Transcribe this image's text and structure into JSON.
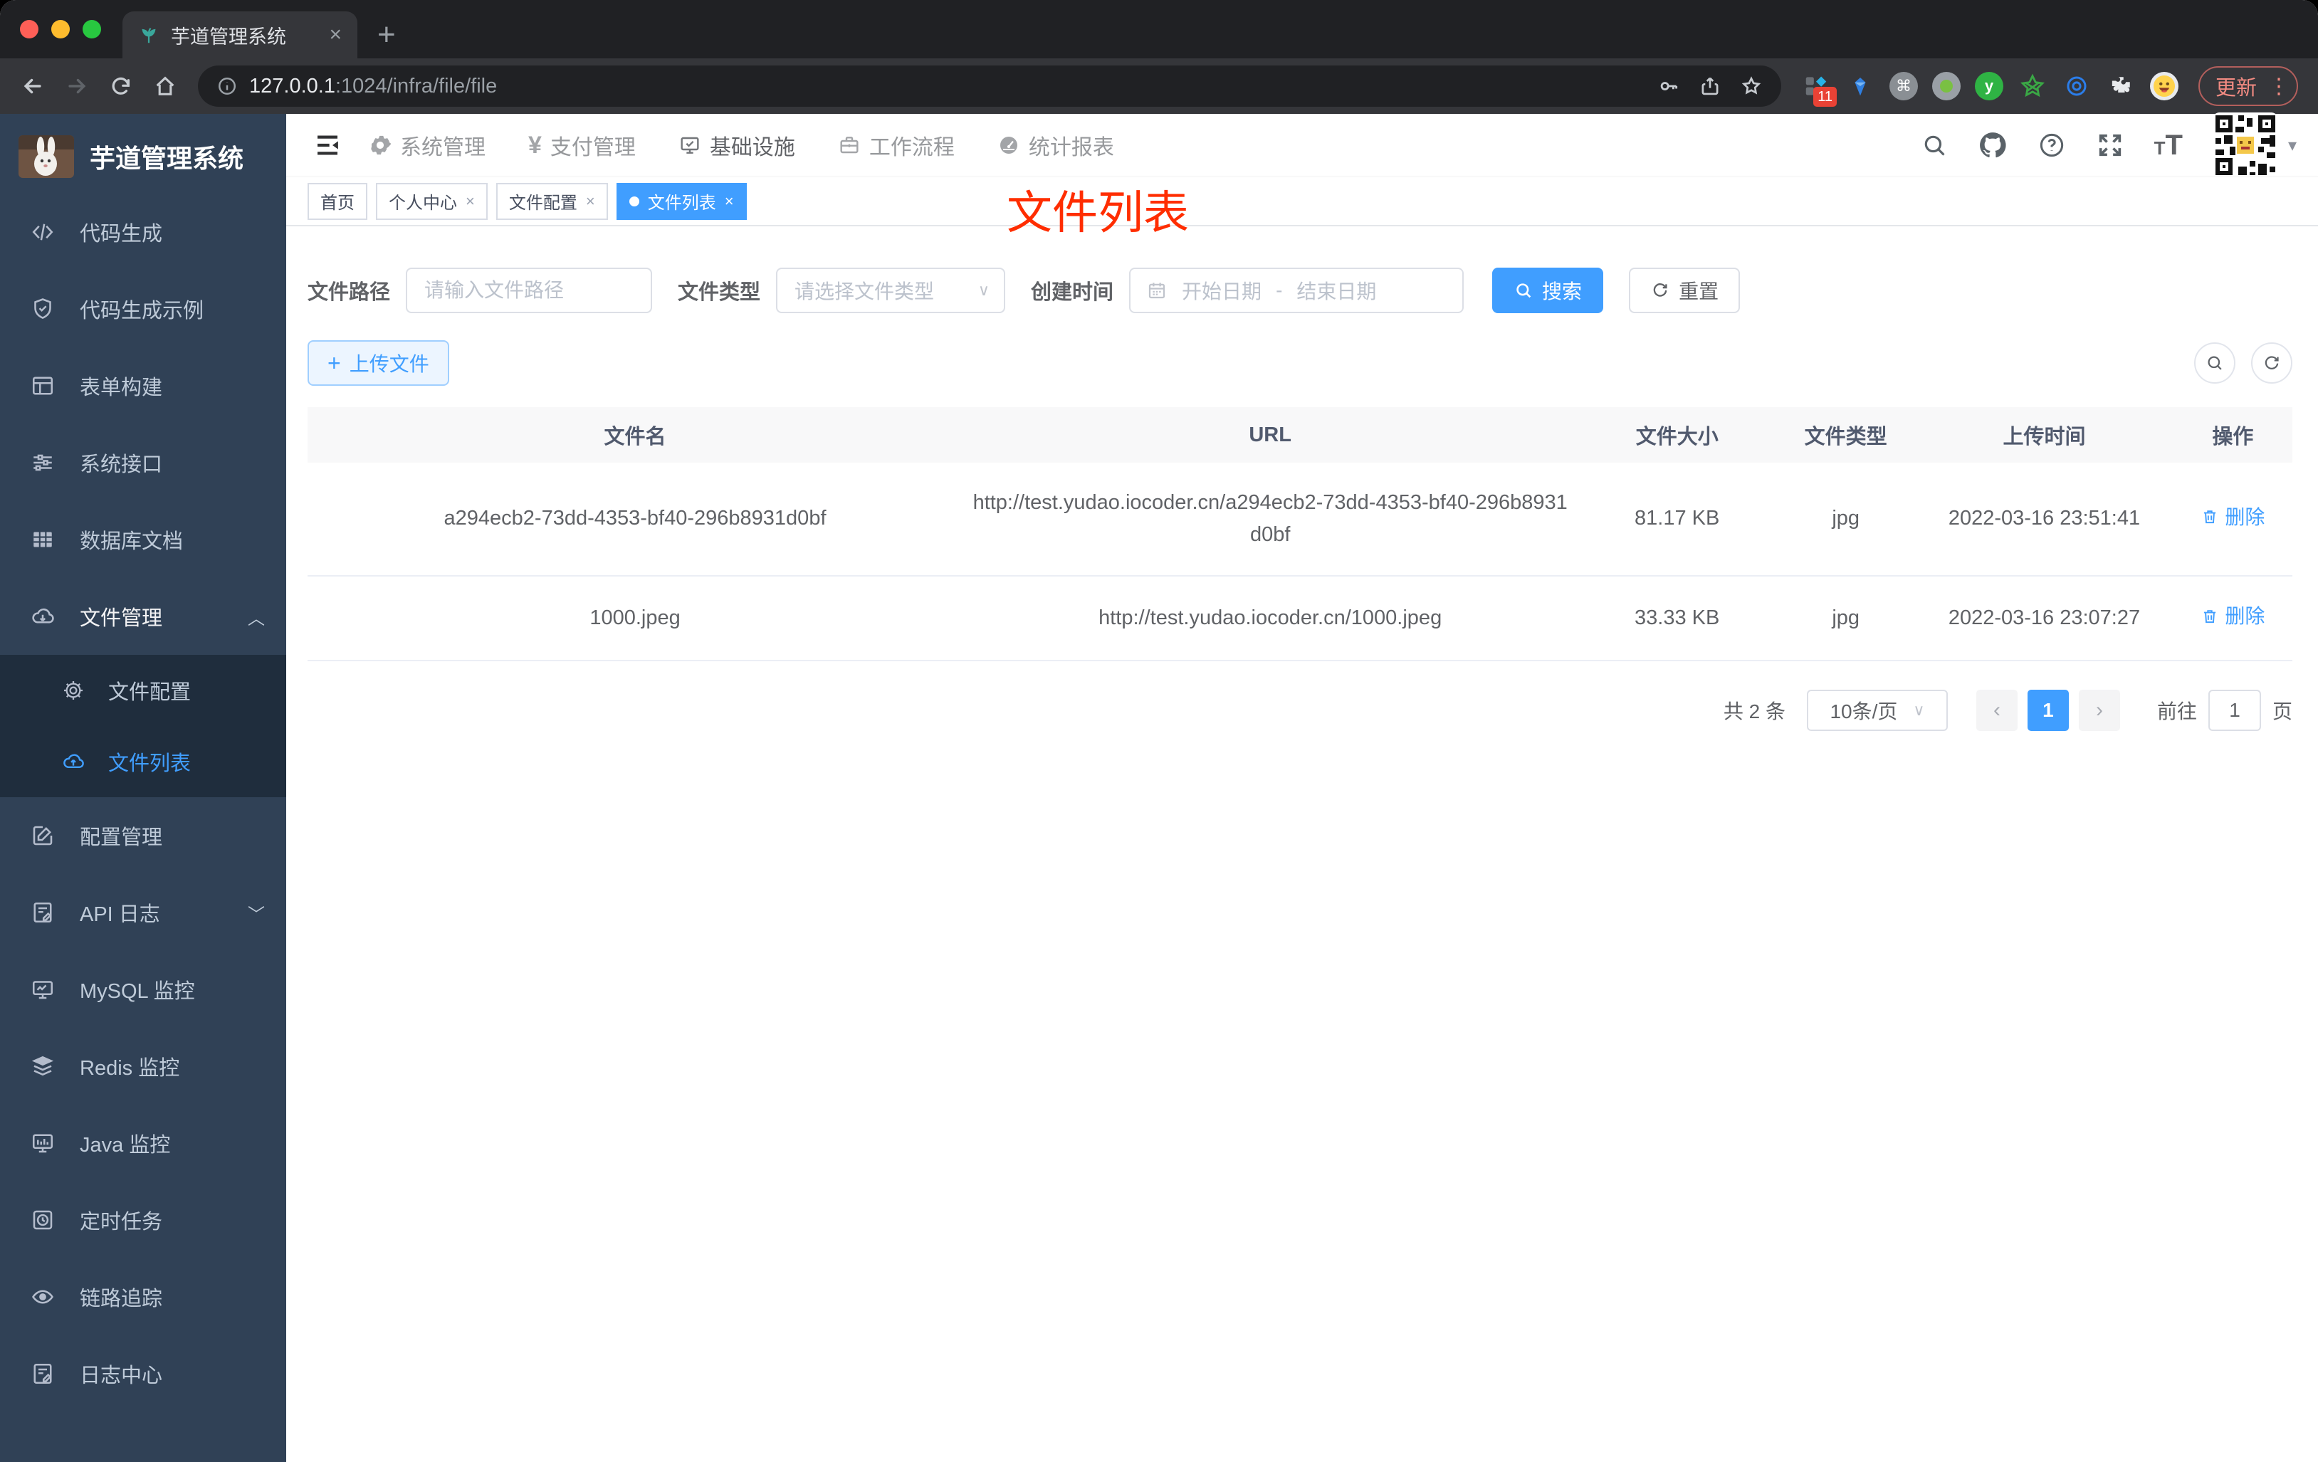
{
  "browser": {
    "tab": {
      "title": "芋道管理系统",
      "close_glyph": "×",
      "new_tab_glyph": "+"
    },
    "url": {
      "host": "127.0.0.1",
      "rest": ":1024/infra/file/file"
    },
    "extension_badge": "11",
    "cmd_glyph": "⌘",
    "ext_y_glyph": "y",
    "update_label": "更新",
    "kebab_glyph": "⋮"
  },
  "sidebar": {
    "logo_title": "芋道管理系统",
    "items": [
      {
        "label": "代码生成"
      },
      {
        "label": "代码生成示例"
      },
      {
        "label": "表单构建"
      },
      {
        "label": "系统接口"
      },
      {
        "label": "数据库文档"
      },
      {
        "label": "文件管理"
      }
    ],
    "expand_chevron_up": "︿",
    "expand_chevron_down": "﹀",
    "submenu": [
      {
        "label": "文件配置"
      },
      {
        "label": "文件列表"
      }
    ],
    "items2": [
      {
        "label": "配置管理"
      },
      {
        "label": "API 日志"
      },
      {
        "label": "MySQL 监控"
      },
      {
        "label": "Redis 监控"
      },
      {
        "label": "Java 监控"
      },
      {
        "label": "定时任务"
      },
      {
        "label": "链路追踪"
      },
      {
        "label": "日志中心"
      }
    ]
  },
  "topnav": {
    "items": [
      {
        "label": "系统管理"
      },
      {
        "label": "支付管理"
      },
      {
        "label": "基础设施"
      },
      {
        "label": "工作流程"
      },
      {
        "label": "统计报表"
      }
    ],
    "yen_glyph": "¥"
  },
  "header": {
    "font_small": "T",
    "font_big": "T",
    "caret": "▾"
  },
  "tags": {
    "close_glyph": "×",
    "items": [
      {
        "label": "首页"
      },
      {
        "label": "个人中心"
      },
      {
        "label": "文件配置"
      },
      {
        "label": "文件列表"
      }
    ]
  },
  "annotation": {
    "text": "文件列表",
    "color": "#ff2d00"
  },
  "filter": {
    "path_label": "文件路径",
    "path_placeholder": "请输入文件路径",
    "type_label": "文件类型",
    "type_placeholder": "请选择文件类型",
    "date_label": "创建时间",
    "date_start_placeholder": "开始日期",
    "date_separator": "-",
    "date_end_placeholder": "结束日期",
    "search_label": "搜索",
    "reset_label": "重置"
  },
  "toolbar": {
    "upload_label": "上传文件",
    "plus_glyph": "+"
  },
  "table": {
    "headers": [
      "文件名",
      "URL",
      "文件大小",
      "文件类型",
      "上传时间",
      "操作"
    ],
    "rows": [
      {
        "name": "a294ecb2-73dd-4353-bf40-296b8931d0bf",
        "url": "http://test.yudao.iocoder.cn/a294ecb2-73dd-4353-bf40-296b8931d0bf",
        "size": "81.17 KB",
        "type": "jpg",
        "time": "2022-03-16 23:51:41",
        "action": "删除"
      },
      {
        "name": "1000.jpeg",
        "url": "http://test.yudao.iocoder.cn/1000.jpeg",
        "size": "33.33 KB",
        "type": "jpg",
        "time": "2022-03-16 23:07:27",
        "action": "删除"
      }
    ]
  },
  "pagination": {
    "total_label": "共 2 条",
    "page_size_label": "10条/页",
    "prev_glyph": "‹",
    "next_glyph": "›",
    "current_page": "1",
    "goto_label": "前往",
    "goto_value": "1",
    "unit_label": "页"
  },
  "colors": {
    "accent": "#409eff",
    "sidebar_bg": "#304156",
    "submenu_bg": "#1f2d3d",
    "annotation_red": "#ff2d00",
    "tag_active_bg": "#409eff",
    "table_header_bg": "#f8f8f9"
  }
}
